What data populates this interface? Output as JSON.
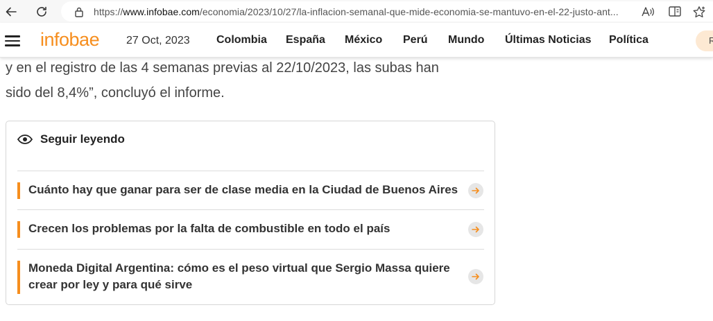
{
  "browser": {
    "url_prefix": "https://",
    "url_host": "www.infobae.com",
    "url_path": "/economia/2023/10/27/la-inflacion-semanal-que-mide-economia-se-mantuvo-en-el-22-justo-ant..."
  },
  "header": {
    "logo": "infobae",
    "date": "27 Oct, 2023",
    "nav": [
      "Colombia",
      "España",
      "México",
      "Perú",
      "Mundo",
      "Últimas Noticias",
      "Política"
    ],
    "pill_label": "R"
  },
  "article": {
    "line1": "y en el registro de las 4 semanas previas al 22/10/2023, las subas han",
    "line2": "sido del 8,4%”, concluyó el informe."
  },
  "related": {
    "title": "Seguir leyendo",
    "items": [
      {
        "title": "Cuánto hay que ganar para ser de clase media en la Ciudad de Buenos Aires"
      },
      {
        "title": "Crecen los problemas por la falta de combustible en todo el país"
      },
      {
        "title": "Moneda Digital Argentina: cómo es el peso virtual que Sergio Massa quiere crear por ley y para qué sirve"
      }
    ]
  },
  "colors": {
    "accent": "#f68e1e",
    "pill_bg": "#fde9d3"
  }
}
